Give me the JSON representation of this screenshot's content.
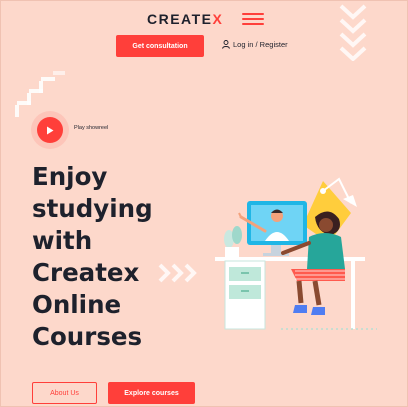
{
  "header": {
    "logo_main": "CREATE",
    "logo_accent": "X",
    "cta_label": "Get consultation",
    "login_label": "Log in / Register"
  },
  "hero": {
    "play_label": "Play showreel",
    "headline_lines": [
      "Enjoy",
      "studying",
      "with",
      "Createx",
      "Online",
      "Courses"
    ],
    "about_label": "About Us",
    "explore_label": "Explore courses"
  },
  "icons": {
    "menu": "hamburger-icon",
    "user": "user-icon",
    "play": "play-icon"
  },
  "colors": {
    "accent": "#ff3f3a",
    "background": "#fdd8cb",
    "text": "#1e212c"
  }
}
